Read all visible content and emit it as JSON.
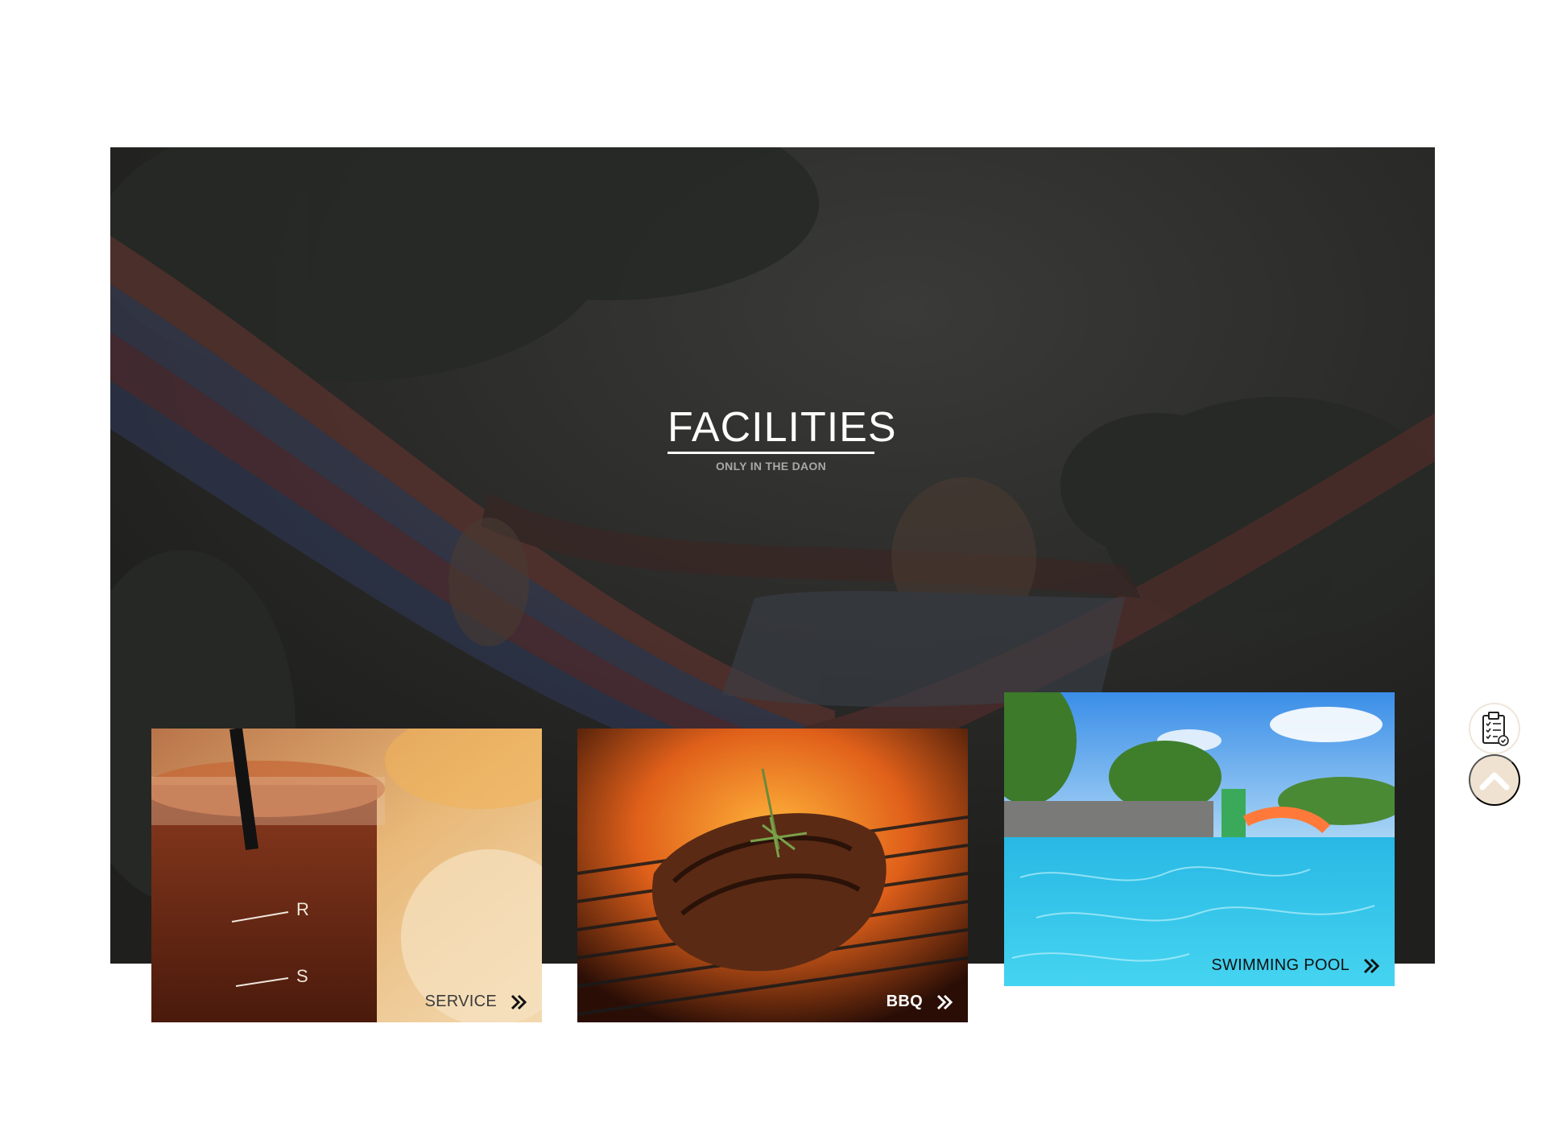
{
  "hero": {
    "title": "FACILITIES",
    "subtitle": "ONLY IN THE DAON"
  },
  "cards": [
    {
      "label": "SERVICE",
      "icon": "double-chevron-right-icon"
    },
    {
      "label": "BBQ",
      "icon": "double-chevron-right-icon"
    },
    {
      "label": "SWIMMING POOL",
      "icon": "double-chevron-right-icon"
    }
  ],
  "floating": {
    "reserve_icon": "clipboard-check-icon",
    "top_icon": "chevron-up-icon"
  },
  "colors": {
    "hero_overlay": "#232321",
    "accent_beige": "#efe2d0",
    "pool_blue": "#2ec4e6"
  }
}
